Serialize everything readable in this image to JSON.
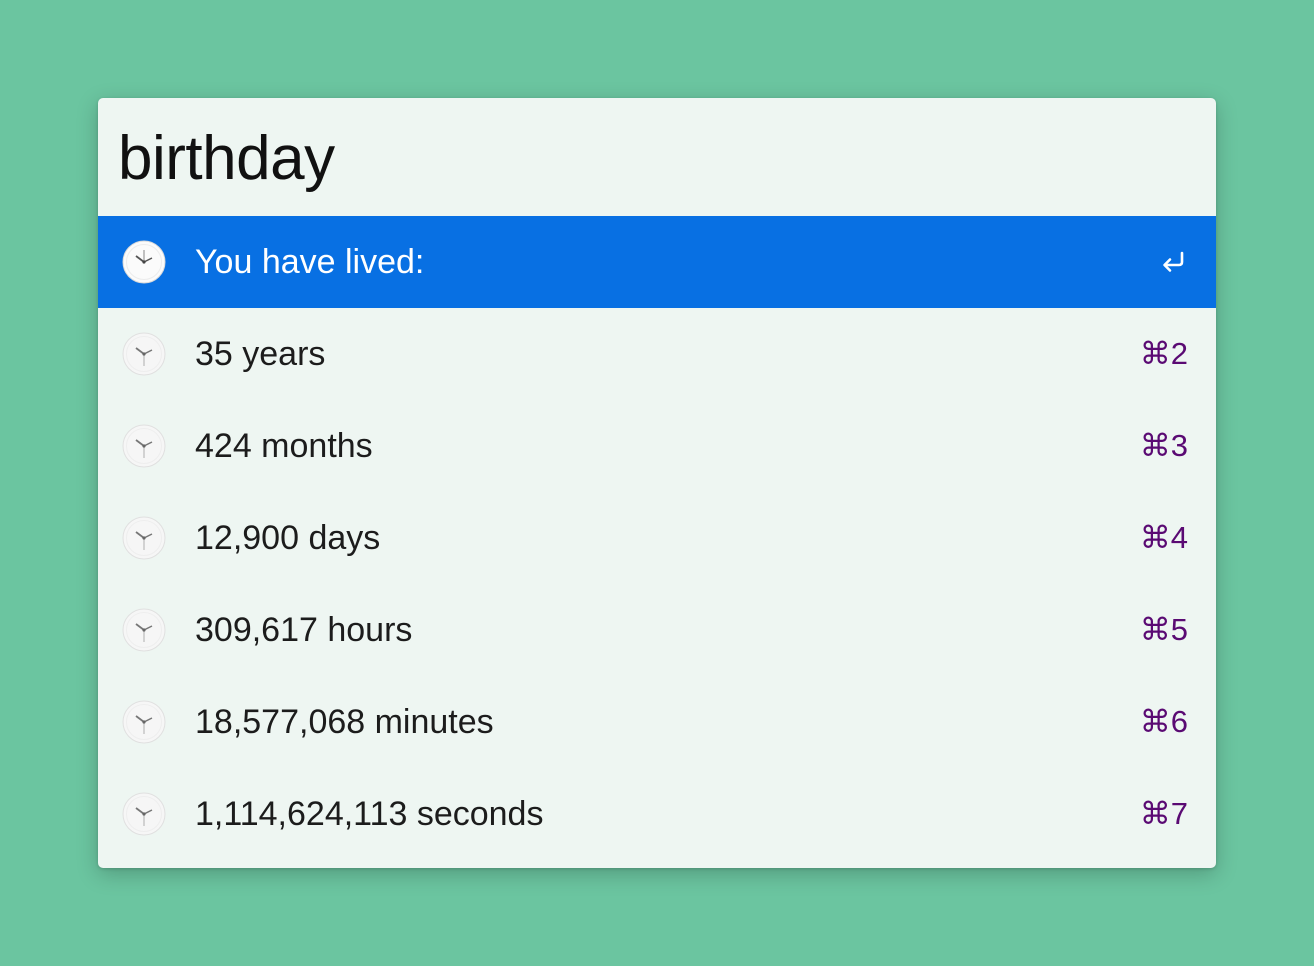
{
  "query": {
    "value": "birthday",
    "placeholder": ""
  },
  "results": [
    {
      "label": "You have lived:",
      "shortcut": "↩",
      "icon": "clock-icon",
      "selected": true
    },
    {
      "label": "35 years",
      "shortcut": "⌘2",
      "icon": "clock-icon",
      "selected": false
    },
    {
      "label": "424 months",
      "shortcut": "⌘3",
      "icon": "clock-icon",
      "selected": false
    },
    {
      "label": "12,900 days",
      "shortcut": "⌘4",
      "icon": "clock-icon",
      "selected": false
    },
    {
      "label": "309,617 hours",
      "shortcut": "⌘5",
      "icon": "clock-icon",
      "selected": false
    },
    {
      "label": "18,577,068 minutes",
      "shortcut": "⌘6",
      "icon": "clock-icon",
      "selected": false
    },
    {
      "label": "1,114,624,113 seconds",
      "shortcut": "⌘7",
      "icon": "clock-icon",
      "selected": false
    }
  ],
  "colors": {
    "background": "#6bc5a0",
    "panel": "#eef6f2",
    "selection": "#0870e3",
    "shortcut": "#5a0a73"
  }
}
